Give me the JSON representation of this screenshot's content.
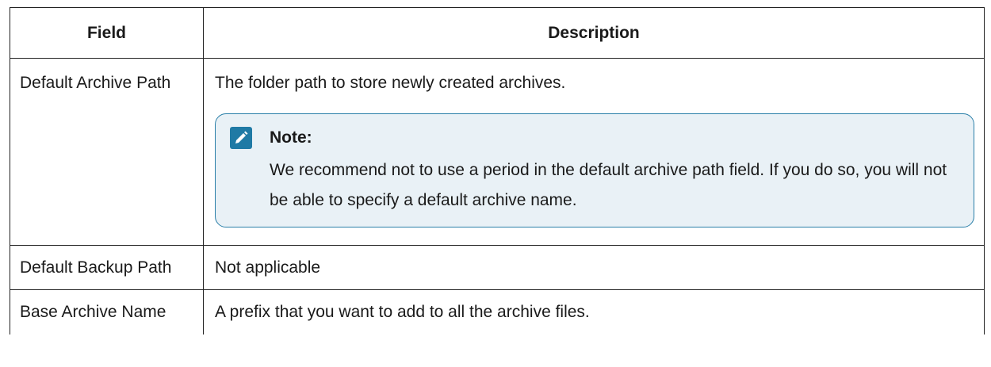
{
  "table": {
    "headers": {
      "field": "Field",
      "description": "Description"
    },
    "rows": [
      {
        "field": "Default Archive Path",
        "description": "The folder path to store newly created archives.",
        "note": {
          "icon": "pencil-icon",
          "title": "Note:",
          "text": "We recommend not to use a period in the default archive path field. If you do so, you will not be able to specify a default archive name."
        }
      },
      {
        "field": "Default Backup Path",
        "description": "Not applicable"
      },
      {
        "field": "Base Archive Name",
        "description": "A prefix that you want to add to all the archive files."
      }
    ]
  },
  "colors": {
    "note_border": "#2a7fa8",
    "note_background": "#e9f1f6",
    "note_icon": "#1f7aa5"
  }
}
